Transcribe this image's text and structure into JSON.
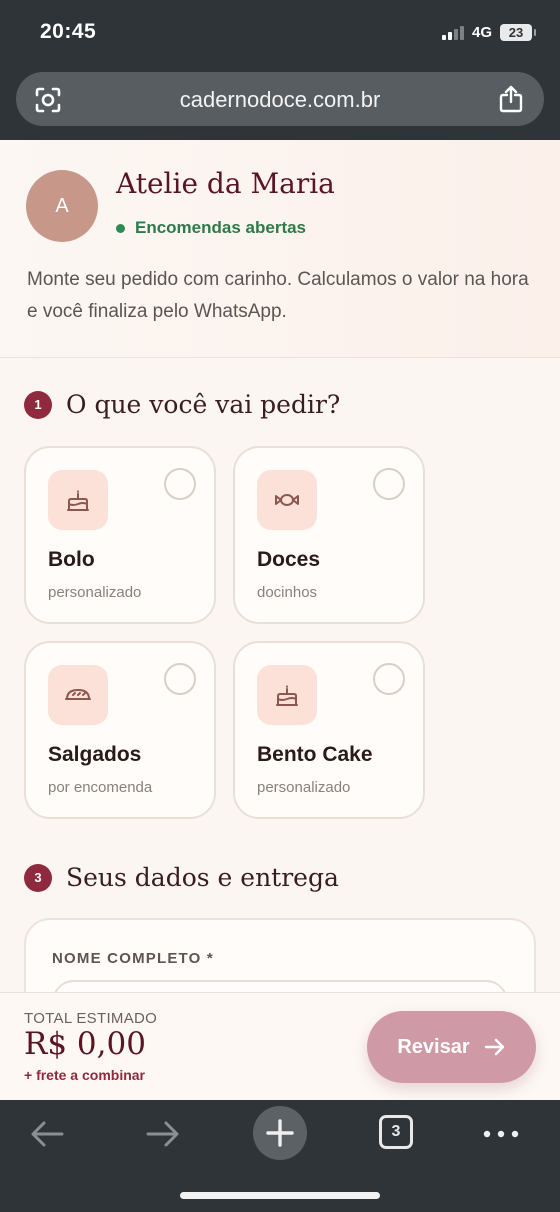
{
  "status_bar": {
    "time": "20:45",
    "network": "4G",
    "battery": "23"
  },
  "browser": {
    "url": "cadernodoce.com.br",
    "tab_count": "3"
  },
  "header": {
    "avatar_letter": "A",
    "shop_name": "Atelie da Maria",
    "status": "Encomendas abertas",
    "intro": "Monte seu pedido com carinho. Calculamos o valor na hora e você finaliza pelo WhatsApp."
  },
  "section1": {
    "step": "1",
    "title": "O que você vai pedir?"
  },
  "products": [
    {
      "title": "Bolo",
      "subtitle": "personalizado",
      "icon": "cake-icon"
    },
    {
      "title": "Doces",
      "subtitle": "docinhos",
      "icon": "candy-icon"
    },
    {
      "title": "Salgados",
      "subtitle": "por encomenda",
      "icon": "bread-icon"
    },
    {
      "title": "Bento Cake",
      "subtitle": "personalizado",
      "icon": "cake-icon"
    }
  ],
  "section3": {
    "step": "3",
    "title": "Seus dados e entrega",
    "name_label": "NOME COMPLETO *"
  },
  "summary": {
    "total_label": "TOTAL ESTIMADO",
    "total_value": "R$ 0,00",
    "freight_note": "+ frete a combinar",
    "review_label": "Revisar"
  },
  "colors": {
    "accent": "#8f2a3e",
    "brand_text": "#5a1523",
    "open_status": "#2f7a4a",
    "button": "#cf9aa6"
  }
}
